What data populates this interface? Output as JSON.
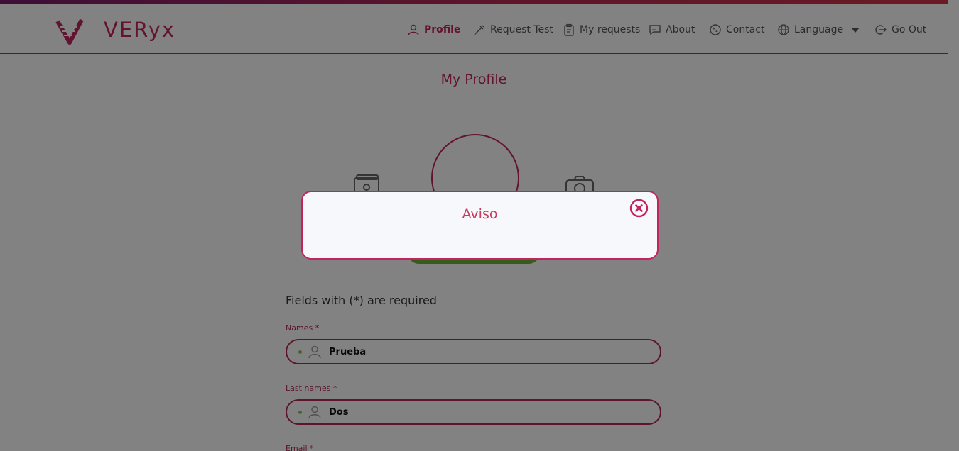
{
  "brand": {
    "name": "VERyx",
    "accent": "#c2245c",
    "icon": "veryx-logo-icon"
  },
  "nav": {
    "items": [
      {
        "label": "Profile",
        "icon": "user-icon",
        "active": true
      },
      {
        "label": "Request Test",
        "icon": "syringe-icon"
      },
      {
        "label": "My requests",
        "icon": "clipboard-icon"
      },
      {
        "label": "About",
        "icon": "chat-icon"
      },
      {
        "label": "Contact",
        "icon": "phone-icon"
      },
      {
        "label": "Language",
        "icon": "globe-icon",
        "caret": "chevron-down-icon"
      },
      {
        "label": "Go Out",
        "icon": "logout-icon"
      }
    ]
  },
  "page": {
    "title": "My Profile"
  },
  "form": {
    "note": "Fields with (*) are required",
    "names": {
      "label": "Names *",
      "value": "Prueba"
    },
    "last_names": {
      "label": "Last names *",
      "value": "Dos"
    },
    "email": {
      "label": "Email *"
    }
  },
  "modal": {
    "title": "Aviso",
    "close_icon": "close-circle-icon"
  },
  "colors": {
    "accent": "#c2245c",
    "upload_bar": "#6bb43a",
    "required_dot": "#8bc34a"
  }
}
